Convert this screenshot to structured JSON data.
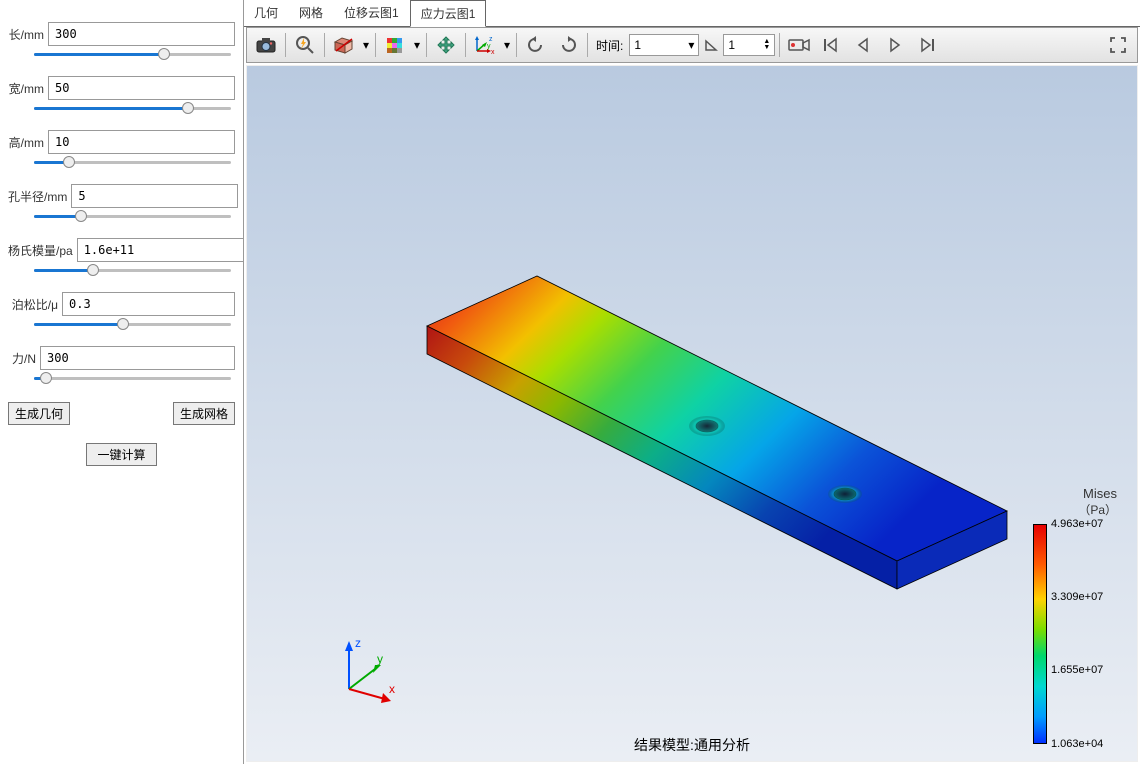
{
  "sidebar": {
    "params": [
      {
        "label": "长/mm",
        "value": "300",
        "labelW": 40,
        "sliderLeft": 26,
        "slider": 66
      },
      {
        "label": "宽/mm",
        "value": "50",
        "labelW": 40,
        "sliderLeft": 26,
        "slider": 78
      },
      {
        "label": "高/mm",
        "value": "10",
        "labelW": 40,
        "sliderLeft": 26,
        "slider": 18
      },
      {
        "label": "孔半径/mm",
        "value": "5",
        "labelW": 66,
        "sliderLeft": 26,
        "slider": 24
      },
      {
        "label": "杨氏模量/pa",
        "value": "1.6e+11",
        "labelW": 72,
        "sliderLeft": 26,
        "slider": 30
      },
      {
        "label": "泊松比/μ",
        "value": "0.3",
        "labelW": 54,
        "sliderLeft": 26,
        "slider": 45
      },
      {
        "label": "力/N",
        "value": "300",
        "labelW": 32,
        "sliderLeft": 26,
        "slider": 6
      }
    ],
    "buttons": {
      "geom": "生成几何",
      "mesh": "生成网格",
      "calc": "一键计算"
    }
  },
  "tabs": {
    "items": [
      {
        "label": "几何"
      },
      {
        "label": "网格"
      },
      {
        "label": "位移云图1"
      },
      {
        "label": "应力云图1"
      }
    ],
    "activeIndex": 3
  },
  "toolbar": {
    "time_label": "时间:",
    "time_value": "1",
    "angle_value": "1"
  },
  "triad": {
    "x": "x",
    "y": "y",
    "z": "z"
  },
  "legend": {
    "title_l1": "Mises",
    "title_l2": "（Pa）",
    "ticks": [
      {
        "pos": 0,
        "label": "4.963e+07"
      },
      {
        "pos": 33,
        "label": "3.309e+07"
      },
      {
        "pos": 66,
        "label": "1.655e+07"
      },
      {
        "pos": 100,
        "label": "1.063e+04"
      }
    ]
  },
  "footer": "结果模型:通用分析",
  "chart_data": {
    "type": "heatmap",
    "title": "Mises（Pa）",
    "colormap": "rainbow",
    "quantity": "von Mises stress",
    "unit": "Pa",
    "range": [
      10630.0,
      49630000.0
    ],
    "legend_ticks": [
      49630000.0,
      33090000.0,
      16550000.0,
      10630.0
    ],
    "geometry": {
      "shape": "rectangular plate with two through-holes",
      "length_mm": 300,
      "width_mm": 50,
      "height_mm": 10,
      "hole_radius_mm": 5,
      "youngs_modulus_pa": 160000000000.0,
      "poisson_ratio": 0.3,
      "applied_force_N": 300
    },
    "qualitative_distribution": "High stress (red) at fixed left end, gradually decreasing (yellow→green→cyan→blue) along the length toward the free right end; local stress concentrations around both holes."
  }
}
